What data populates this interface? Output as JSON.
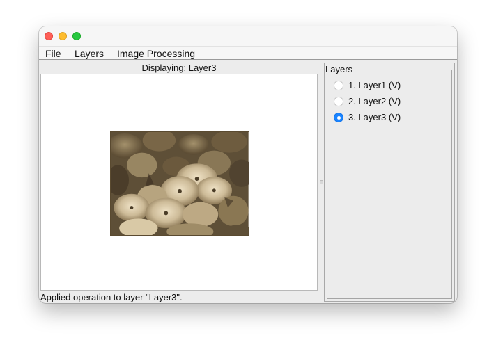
{
  "menubar": {
    "items": [
      {
        "label": "File"
      },
      {
        "label": "Layers"
      },
      {
        "label": "Image Processing"
      }
    ]
  },
  "display": {
    "title": "Displaying: Layer3",
    "image": {
      "filter": "sepia"
    }
  },
  "status": "Applied operation to layer \"Layer3\".",
  "layers_panel": {
    "title": "Layers",
    "layers": [
      {
        "label": "1. Layer1 (V)",
        "selected": false
      },
      {
        "label": "2. Layer2 (V)",
        "selected": false
      },
      {
        "label": "3. Layer3 (V)",
        "selected": true
      }
    ]
  },
  "colors": {
    "radio_selected": "#1a84ff",
    "window_bg": "#ececec",
    "traffic_close": "#fe5f57",
    "traffic_minimize": "#febc2e",
    "traffic_maximize": "#28c840"
  }
}
